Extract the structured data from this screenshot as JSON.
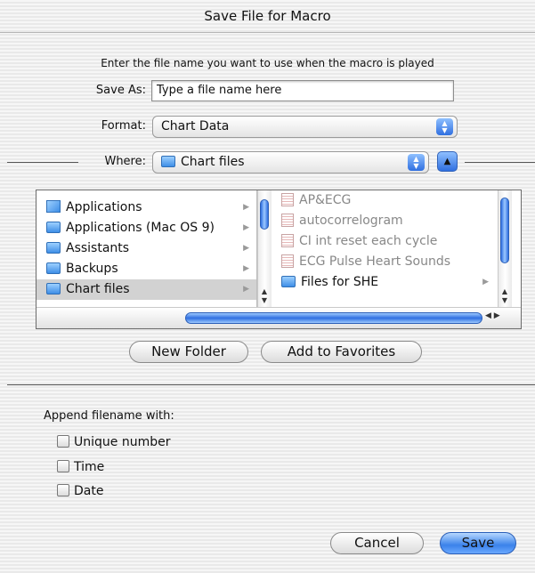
{
  "window": {
    "title": "Save File for Macro"
  },
  "instruction": "Enter the file name you want to use when the macro is played",
  "save_as": {
    "label": "Save As:",
    "value": "Type a file name here"
  },
  "format": {
    "label": "Format:",
    "value": "Chart Data"
  },
  "where": {
    "label": "Where:",
    "value": "Chart files"
  },
  "browser": {
    "column1": [
      {
        "label": "Applications",
        "icon": "applications-folder-icon"
      },
      {
        "label": "Applications (Mac OS 9)",
        "icon": "folder-icon"
      },
      {
        "label": "Assistants",
        "icon": "folder-icon"
      },
      {
        "label": "Backups",
        "icon": "folder-icon"
      },
      {
        "label": "Chart files",
        "icon": "folder-icon",
        "selected": true
      }
    ],
    "column2": [
      {
        "label": "AP&ECG",
        "icon": "chart-document-icon"
      },
      {
        "label": "autocorrelogram",
        "icon": "chart-document-icon"
      },
      {
        "label": "CI int reset each cycle",
        "icon": "chart-document-icon"
      },
      {
        "label": "ECG Pulse Heart Sounds",
        "icon": "chart-document-icon"
      },
      {
        "label": "Files for SHE",
        "icon": "folder-icon"
      }
    ]
  },
  "buttons": {
    "new_folder": "New Folder",
    "add_favorites": "Add to Favorites",
    "cancel": "Cancel",
    "save": "Save"
  },
  "append": {
    "label": "Append filename with:",
    "options": [
      "Unique number",
      "Time",
      "Date"
    ]
  },
  "colors": {
    "accent": "#3b82ea",
    "selection": "#d2d2d2"
  }
}
